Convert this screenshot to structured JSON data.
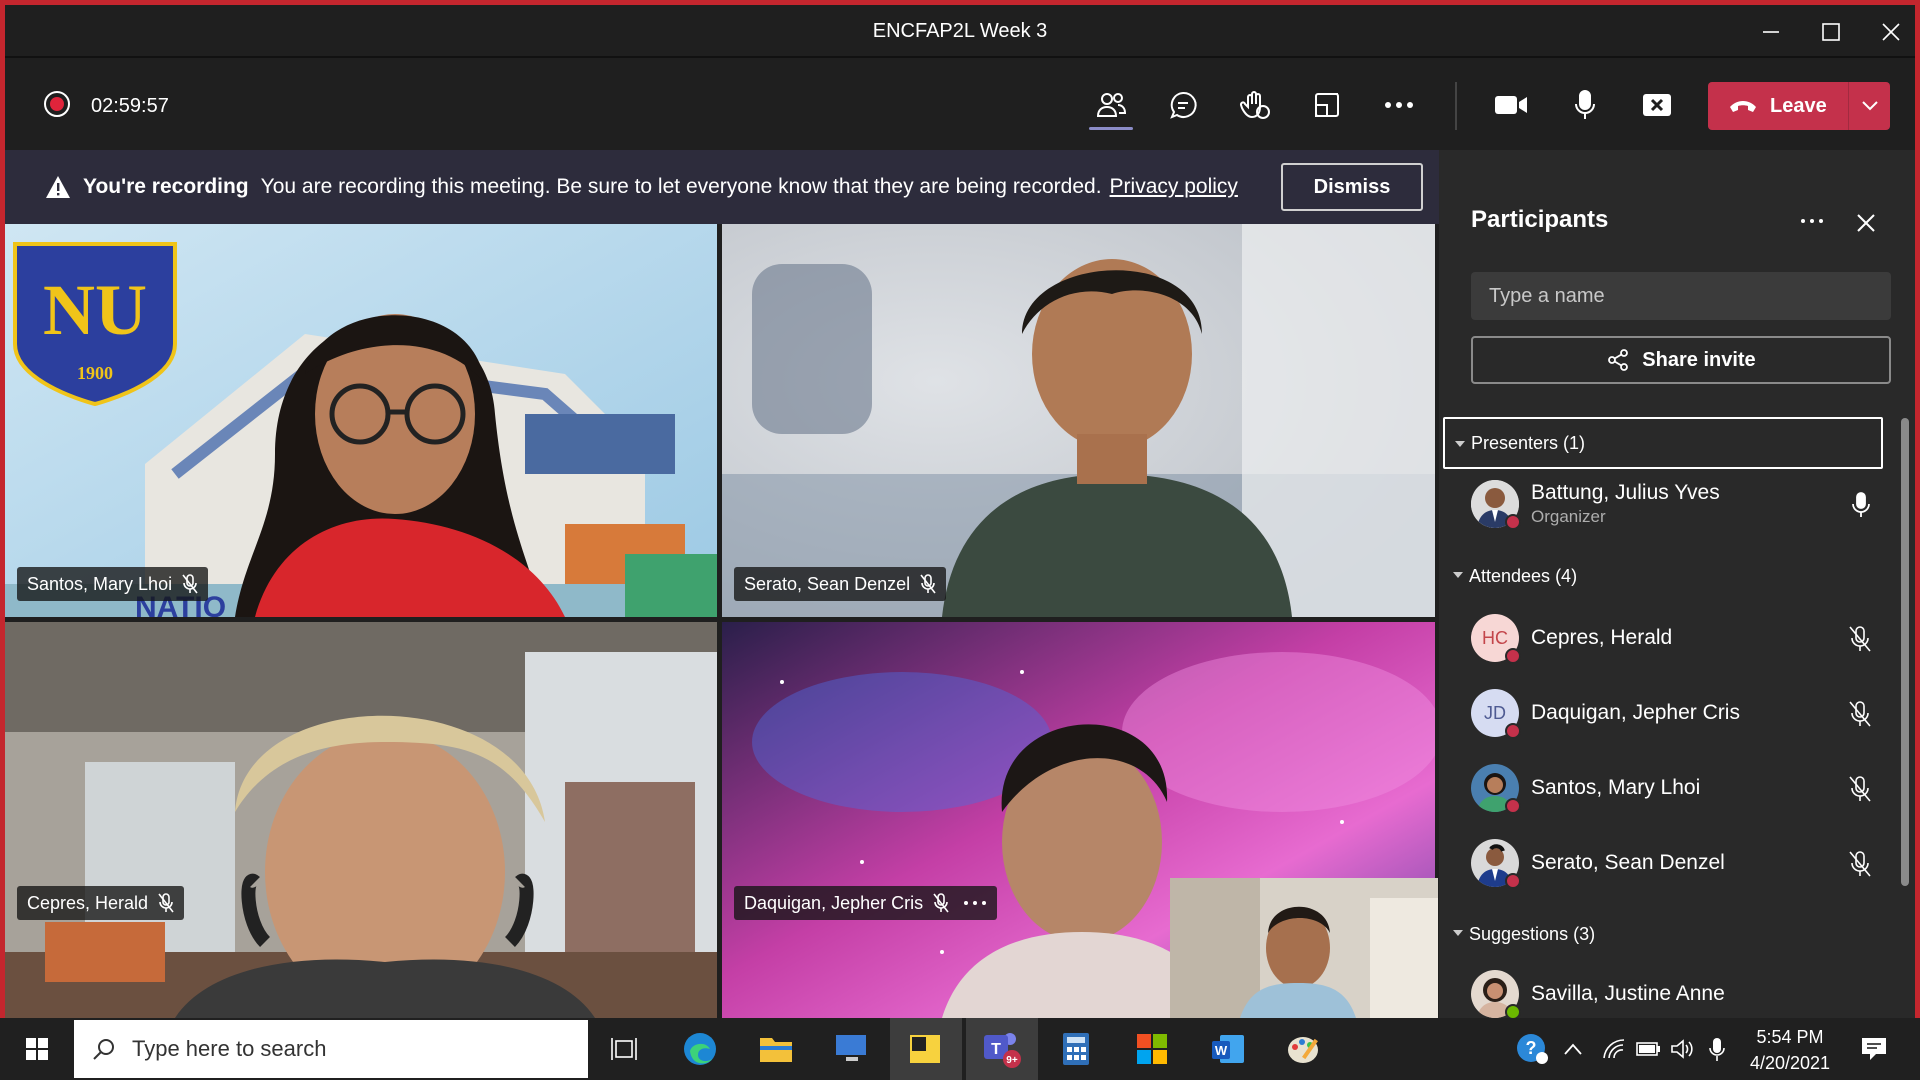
{
  "window": {
    "title": "ENCFAP2L Week 3"
  },
  "toolbar": {
    "timer": "02:59:57",
    "leave_label": "Leave"
  },
  "banner": {
    "heading": "You're recording",
    "message": "You are recording this meeting. Be sure to let everyone know that they are being recorded.",
    "privacy_link": "Privacy policy",
    "dismiss_label": "Dismiss"
  },
  "video": {
    "tiles": [
      {
        "name": "Santos, Mary Lhoi",
        "logo_text": "NU",
        "logo_year": "1900",
        "logo_bottom": "NATIO"
      },
      {
        "name": "Serato, Sean Denzel"
      },
      {
        "name": "Cepres, Herald"
      },
      {
        "name": "Daquigan, Jepher Cris"
      }
    ]
  },
  "participants": {
    "title": "Participants",
    "search_placeholder": "Type a name",
    "share_label": "Share invite",
    "presenters": {
      "label": "Presenters (1)",
      "items": [
        {
          "name": "Battung, Julius Yves",
          "role": "Organizer"
        }
      ]
    },
    "attendees": {
      "label": "Attendees (4)",
      "items": [
        {
          "name": "Cepres, Herald",
          "initials": "HC",
          "avatar_color": "#f7d7d5",
          "initials_color": "#c3454a"
        },
        {
          "name": "Daquigan, Jepher Cris",
          "initials": "JD",
          "avatar_color": "#d6dcf2",
          "initials_color": "#4f5b93"
        },
        {
          "name": "Santos, Mary Lhoi"
        },
        {
          "name": "Serato, Sean Denzel"
        }
      ]
    },
    "suggestions": {
      "label": "Suggestions (3)",
      "items": [
        {
          "name": "Savilla, Justine Anne"
        }
      ]
    }
  },
  "taskbar": {
    "search_placeholder": "Type here to search",
    "teams_badge": "9+",
    "time": "5:54 PM",
    "date": "4/20/2021"
  },
  "colors": {
    "accent": "#c4314b",
    "recording": "#e0243b",
    "window_border": "#c4262e",
    "available": "#6bb700"
  }
}
